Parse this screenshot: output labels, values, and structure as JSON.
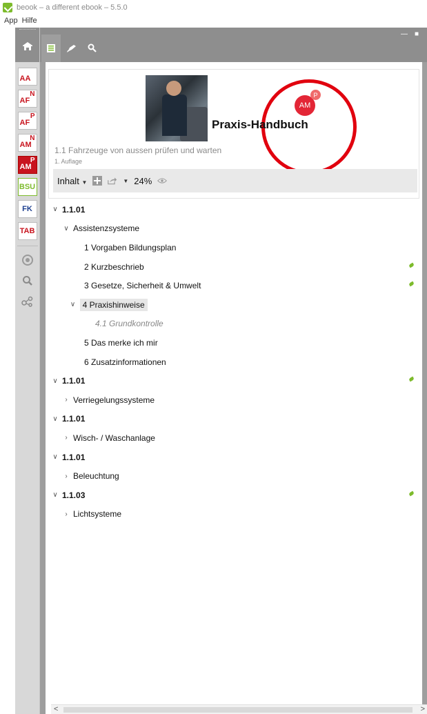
{
  "window": {
    "title": "beook – a different ebook – 5.5.0"
  },
  "menu": {
    "items": [
      "App",
      "Hilfe"
    ]
  },
  "rail": {
    "books": [
      {
        "label": "AA",
        "sup": "",
        "style": "normal"
      },
      {
        "label": "AF",
        "sup": "N",
        "style": "normal"
      },
      {
        "label": "AF",
        "sup": "P",
        "style": "normal"
      },
      {
        "label": "AM",
        "sup": "N",
        "style": "normal"
      },
      {
        "label": "AM",
        "sup": "P",
        "style": "active"
      },
      {
        "label": "BSU",
        "sup": "",
        "style": "bsu"
      },
      {
        "label": "FK",
        "sup": "",
        "style": "fk"
      },
      {
        "label": "TAB",
        "sup": "",
        "style": "normal"
      }
    ]
  },
  "book": {
    "title": "Praxis-Handbuch",
    "subtitle": "1.1 Fahrzeuge von aussen prüfen und warten",
    "edition": "1. Auflage",
    "badge": "AM",
    "badge_sup": "P"
  },
  "toolbar": {
    "content_label": "Inhalt",
    "zoom": "24%"
  },
  "tree": [
    {
      "chev": "open",
      "label": "1.1.01",
      "indent": 0,
      "bold": true,
      "dot": false
    },
    {
      "chev": "open",
      "label": "Assistenzsysteme",
      "indent": 1,
      "dot": false
    },
    {
      "chev": "",
      "label": "1 Vorgaben Bildungsplan",
      "indent": 2,
      "dot": false
    },
    {
      "chev": "",
      "label": "2 Kurzbeschrieb",
      "indent": 2,
      "dot": true
    },
    {
      "chev": "",
      "label": "3 Gesetze, Sicherheit & Umwelt",
      "indent": 2,
      "dot": true
    },
    {
      "chev": "open",
      "label": "4 Praxishinweise",
      "indent": 1.6,
      "selected": true,
      "dot": false
    },
    {
      "chev": "",
      "label": "4.1  Grundkontrolle",
      "indent": 3,
      "italic": true,
      "dot": false
    },
    {
      "chev": "",
      "label": "5 Das merke ich mir",
      "indent": 2,
      "dot": false
    },
    {
      "chev": "",
      "label": "6 Zusatzinformationen",
      "indent": 2,
      "dot": false
    },
    {
      "chev": "open",
      "label": "1.1.01",
      "indent": 0,
      "bold": true,
      "dot": true
    },
    {
      "chev": "closed",
      "label": "Verriegelungssysteme",
      "indent": 1,
      "dot": false
    },
    {
      "chev": "open",
      "label": "1.1.01",
      "indent": 0,
      "bold": true,
      "dot": false
    },
    {
      "chev": "closed",
      "label": "Wisch- / Waschanlage",
      "indent": 1,
      "dot": false
    },
    {
      "chev": "open",
      "label": "1.1.01",
      "indent": 0,
      "bold": true,
      "dot": false
    },
    {
      "chev": "closed",
      "label": "Beleuchtung",
      "indent": 1,
      "dot": false
    },
    {
      "chev": "open",
      "label": "1.1.03",
      "indent": 0,
      "bold": true,
      "dot": true
    },
    {
      "chev": "closed",
      "label": "Lichtsysteme",
      "indent": 1,
      "dot": false
    }
  ]
}
